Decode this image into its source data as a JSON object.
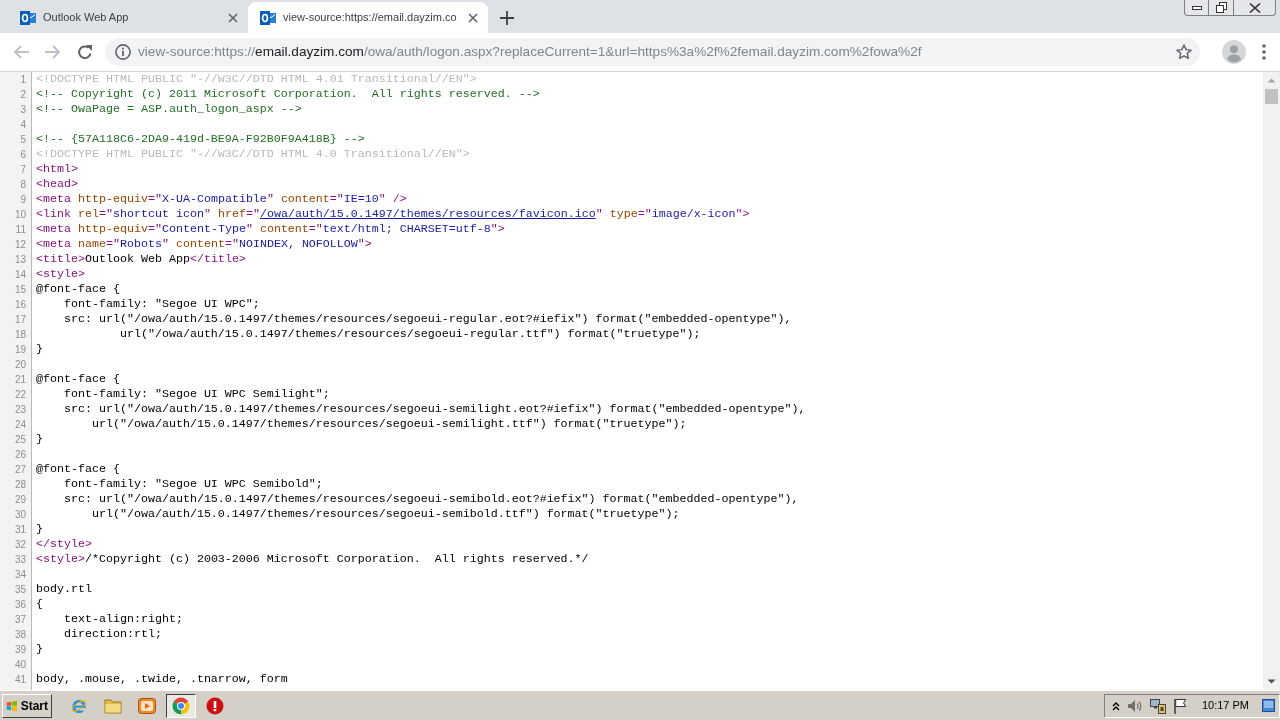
{
  "tabs": [
    {
      "title": "Outlook Web App",
      "selected": false
    },
    {
      "title": "view-source:https://email.dayzim.co",
      "selected": true
    }
  ],
  "toolbar": {
    "buttons": [
      {
        "kind": "back",
        "disabled": true
      },
      {
        "kind": "forward",
        "disabled": true
      },
      {
        "kind": "reload",
        "disabled": false
      }
    ],
    "address": [
      {
        "kind": "dim",
        "text": "view-source:https://"
      },
      {
        "kind": "host",
        "text": "email.dayzim.com"
      },
      {
        "kind": "dim",
        "text": "/owa/auth/logon.aspx?replaceCurrent=1&url=https%3a%2f%2femail.dayzim.com%2fowa%2f"
      }
    ]
  },
  "source": {
    "lines": [
      {
        "number": "1",
        "tokens": [
          {
            "kind": "doctype",
            "text": "<!DOCTYPE HTML PUBLIC \"-//W3C//DTD HTML 4.01 Transitional//EN\">"
          }
        ]
      },
      {
        "number": "2",
        "tokens": [
          {
            "kind": "comment",
            "text": "<!-- Copyright (c) 2011 Microsoft Corporation.  All rights reserved. -->"
          }
        ]
      },
      {
        "number": "3",
        "tokens": [
          {
            "kind": "comment",
            "text": "<!-- OwaPage = ASP.auth_logon_aspx -->"
          }
        ]
      },
      {
        "number": "4"
      },
      {
        "number": "5",
        "tokens": [
          {
            "kind": "comment",
            "text": "<!-- {57A118C6-2DA9-419d-BE9A-F92B0F9A418B} -->"
          }
        ]
      },
      {
        "number": "6",
        "tokens": [
          {
            "kind": "doctype",
            "text": "<!DOCTYPE HTML PUBLIC \"-//W3C//DTD HTML 4.0 Transitional//EN\">"
          }
        ]
      },
      {
        "number": "7",
        "tokens": [
          {
            "kind": "tag",
            "text": "<html>"
          }
        ]
      },
      {
        "number": "8",
        "tokens": [
          {
            "kind": "tag",
            "text": "<head>"
          }
        ]
      },
      {
        "number": "9",
        "tokens": [
          {
            "kind": "tag",
            "text": "<meta "
          },
          {
            "kind": "attr",
            "text": "http-equiv"
          },
          {
            "kind": "tag",
            "text": "=\""
          },
          {
            "kind": "value",
            "text": "X-UA-Compatible"
          },
          {
            "kind": "tag",
            "text": "\" "
          },
          {
            "kind": "attr",
            "text": "content"
          },
          {
            "kind": "tag",
            "text": "=\""
          },
          {
            "kind": "value",
            "text": "IE=10"
          },
          {
            "kind": "tag",
            "text": "\" />"
          }
        ]
      },
      {
        "number": "10",
        "tokens": [
          {
            "kind": "tag",
            "text": "<link "
          },
          {
            "kind": "attr",
            "text": "rel"
          },
          {
            "kind": "tag",
            "text": "=\""
          },
          {
            "kind": "value",
            "text": "shortcut icon"
          },
          {
            "kind": "tag",
            "text": "\" "
          },
          {
            "kind": "attr",
            "text": "href"
          },
          {
            "kind": "tag",
            "text": "=\""
          },
          {
            "kind": "link",
            "text": "/owa/auth/15.0.1497/themes/resources/favicon.ico"
          },
          {
            "kind": "tag",
            "text": "\" "
          },
          {
            "kind": "attr",
            "text": "type"
          },
          {
            "kind": "tag",
            "text": "=\""
          },
          {
            "kind": "value",
            "text": "image/x-icon"
          },
          {
            "kind": "tag",
            "text": "\">"
          }
        ]
      },
      {
        "number": "11",
        "tokens": [
          {
            "kind": "tag",
            "text": "<meta "
          },
          {
            "kind": "attr",
            "text": "http-equiv"
          },
          {
            "kind": "tag",
            "text": "=\""
          },
          {
            "kind": "value",
            "text": "Content-Type"
          },
          {
            "kind": "tag",
            "text": "\" "
          },
          {
            "kind": "attr",
            "text": "content"
          },
          {
            "kind": "tag",
            "text": "=\""
          },
          {
            "kind": "value",
            "text": "text/html; CHARSET=utf-8"
          },
          {
            "kind": "tag",
            "text": "\">"
          }
        ]
      },
      {
        "number": "12",
        "tokens": [
          {
            "kind": "tag",
            "text": "<meta "
          },
          {
            "kind": "attr",
            "text": "name"
          },
          {
            "kind": "tag",
            "text": "=\""
          },
          {
            "kind": "value",
            "text": "Robots"
          },
          {
            "kind": "tag",
            "text": "\" "
          },
          {
            "kind": "attr",
            "text": "content"
          },
          {
            "kind": "tag",
            "text": "=\""
          },
          {
            "kind": "value",
            "text": "NOINDEX, NOFOLLOW"
          },
          {
            "kind": "tag",
            "text": "\">"
          }
        ]
      },
      {
        "number": "13",
        "tokens": [
          {
            "kind": "tag",
            "text": "<title>"
          },
          {
            "kind": "text",
            "text": "Outlook Web App"
          },
          {
            "kind": "tag",
            "text": "</title>"
          }
        ]
      },
      {
        "number": "14",
        "tokens": [
          {
            "kind": "tag",
            "text": "<style>"
          }
        ]
      },
      {
        "number": "15",
        "tokens": [
          {
            "kind": "text",
            "text": "@font-face {"
          }
        ]
      },
      {
        "number": "16",
        "tokens": [
          {
            "kind": "text",
            "text": "    font-family: \"Segoe UI WPC\";"
          }
        ]
      },
      {
        "number": "17",
        "tokens": [
          {
            "kind": "text",
            "text": "    src: url(\"/owa/auth/15.0.1497/themes/resources/segoeui-regular.eot?#iefix\") format(\"embedded-opentype\"),"
          }
        ]
      },
      {
        "number": "18",
        "tokens": [
          {
            "kind": "text",
            "text": "            url(\"/owa/auth/15.0.1497/themes/resources/segoeui-regular.ttf\") format(\"truetype\");"
          }
        ]
      },
      {
        "number": "19",
        "tokens": [
          {
            "kind": "text",
            "text": "}"
          }
        ]
      },
      {
        "number": "20"
      },
      {
        "number": "21",
        "tokens": [
          {
            "kind": "text",
            "text": "@font-face {"
          }
        ]
      },
      {
        "number": "22",
        "tokens": [
          {
            "kind": "text",
            "text": "    font-family: \"Segoe UI WPC Semilight\";"
          }
        ]
      },
      {
        "number": "23",
        "tokens": [
          {
            "kind": "text",
            "text": "    src: url(\"/owa/auth/15.0.1497/themes/resources/segoeui-semilight.eot?#iefix\") format(\"embedded-opentype\"),"
          }
        ]
      },
      {
        "number": "24",
        "tokens": [
          {
            "kind": "text",
            "text": "        url(\"/owa/auth/15.0.1497/themes/resources/segoeui-semilight.ttf\") format(\"truetype\");"
          }
        ]
      },
      {
        "number": "25",
        "tokens": [
          {
            "kind": "text",
            "text": "}"
          }
        ]
      },
      {
        "number": "26"
      },
      {
        "number": "27",
        "tokens": [
          {
            "kind": "text",
            "text": "@font-face {"
          }
        ]
      },
      {
        "number": "28",
        "tokens": [
          {
            "kind": "text",
            "text": "    font-family: \"Segoe UI WPC Semibold\";"
          }
        ]
      },
      {
        "number": "29",
        "tokens": [
          {
            "kind": "text",
            "text": "    src: url(\"/owa/auth/15.0.1497/themes/resources/segoeui-semibold.eot?#iefix\") format(\"embedded-opentype\"),"
          }
        ]
      },
      {
        "number": "30",
        "tokens": [
          {
            "kind": "text",
            "text": "        url(\"/owa/auth/15.0.1497/themes/resources/segoeui-semibold.ttf\") format(\"truetype\");"
          }
        ]
      },
      {
        "number": "31",
        "tokens": [
          {
            "kind": "text",
            "text": "}"
          }
        ]
      },
      {
        "number": "32",
        "tokens": [
          {
            "kind": "tag",
            "text": "</style>"
          }
        ]
      },
      {
        "number": "33",
        "tokens": [
          {
            "kind": "tag",
            "text": "<style>"
          },
          {
            "kind": "text",
            "text": "/*Copyright (c) 2003-2006 Microsoft Corporation.  All rights reserved.*/"
          }
        ]
      },
      {
        "number": "34"
      },
      {
        "number": "35",
        "tokens": [
          {
            "kind": "text",
            "text": "body.rtl"
          }
        ]
      },
      {
        "number": "36",
        "tokens": [
          {
            "kind": "text",
            "text": "{"
          }
        ]
      },
      {
        "number": "37",
        "tokens": [
          {
            "kind": "text",
            "text": "    text-align:right;"
          }
        ]
      },
      {
        "number": "38",
        "tokens": [
          {
            "kind": "text",
            "text": "    direction:rtl;"
          }
        ]
      },
      {
        "number": "39",
        "tokens": [
          {
            "kind": "text",
            "text": "}"
          }
        ]
      },
      {
        "number": "40"
      },
      {
        "number": "41",
        "tokens": [
          {
            "kind": "text",
            "text": "body, .mouse, .twide, .tnarrow, form"
          }
        ]
      }
    ]
  },
  "taskbar": {
    "start_label": "Start",
    "apps": [
      {
        "kind": "globe",
        "selected": false
      },
      {
        "kind": "folder",
        "selected": false
      },
      {
        "kind": "player",
        "selected": false
      },
      {
        "kind": "round",
        "selected": true
      },
      {
        "kind": "alert",
        "selected": false
      }
    ],
    "clock": "10:17 PM"
  }
}
